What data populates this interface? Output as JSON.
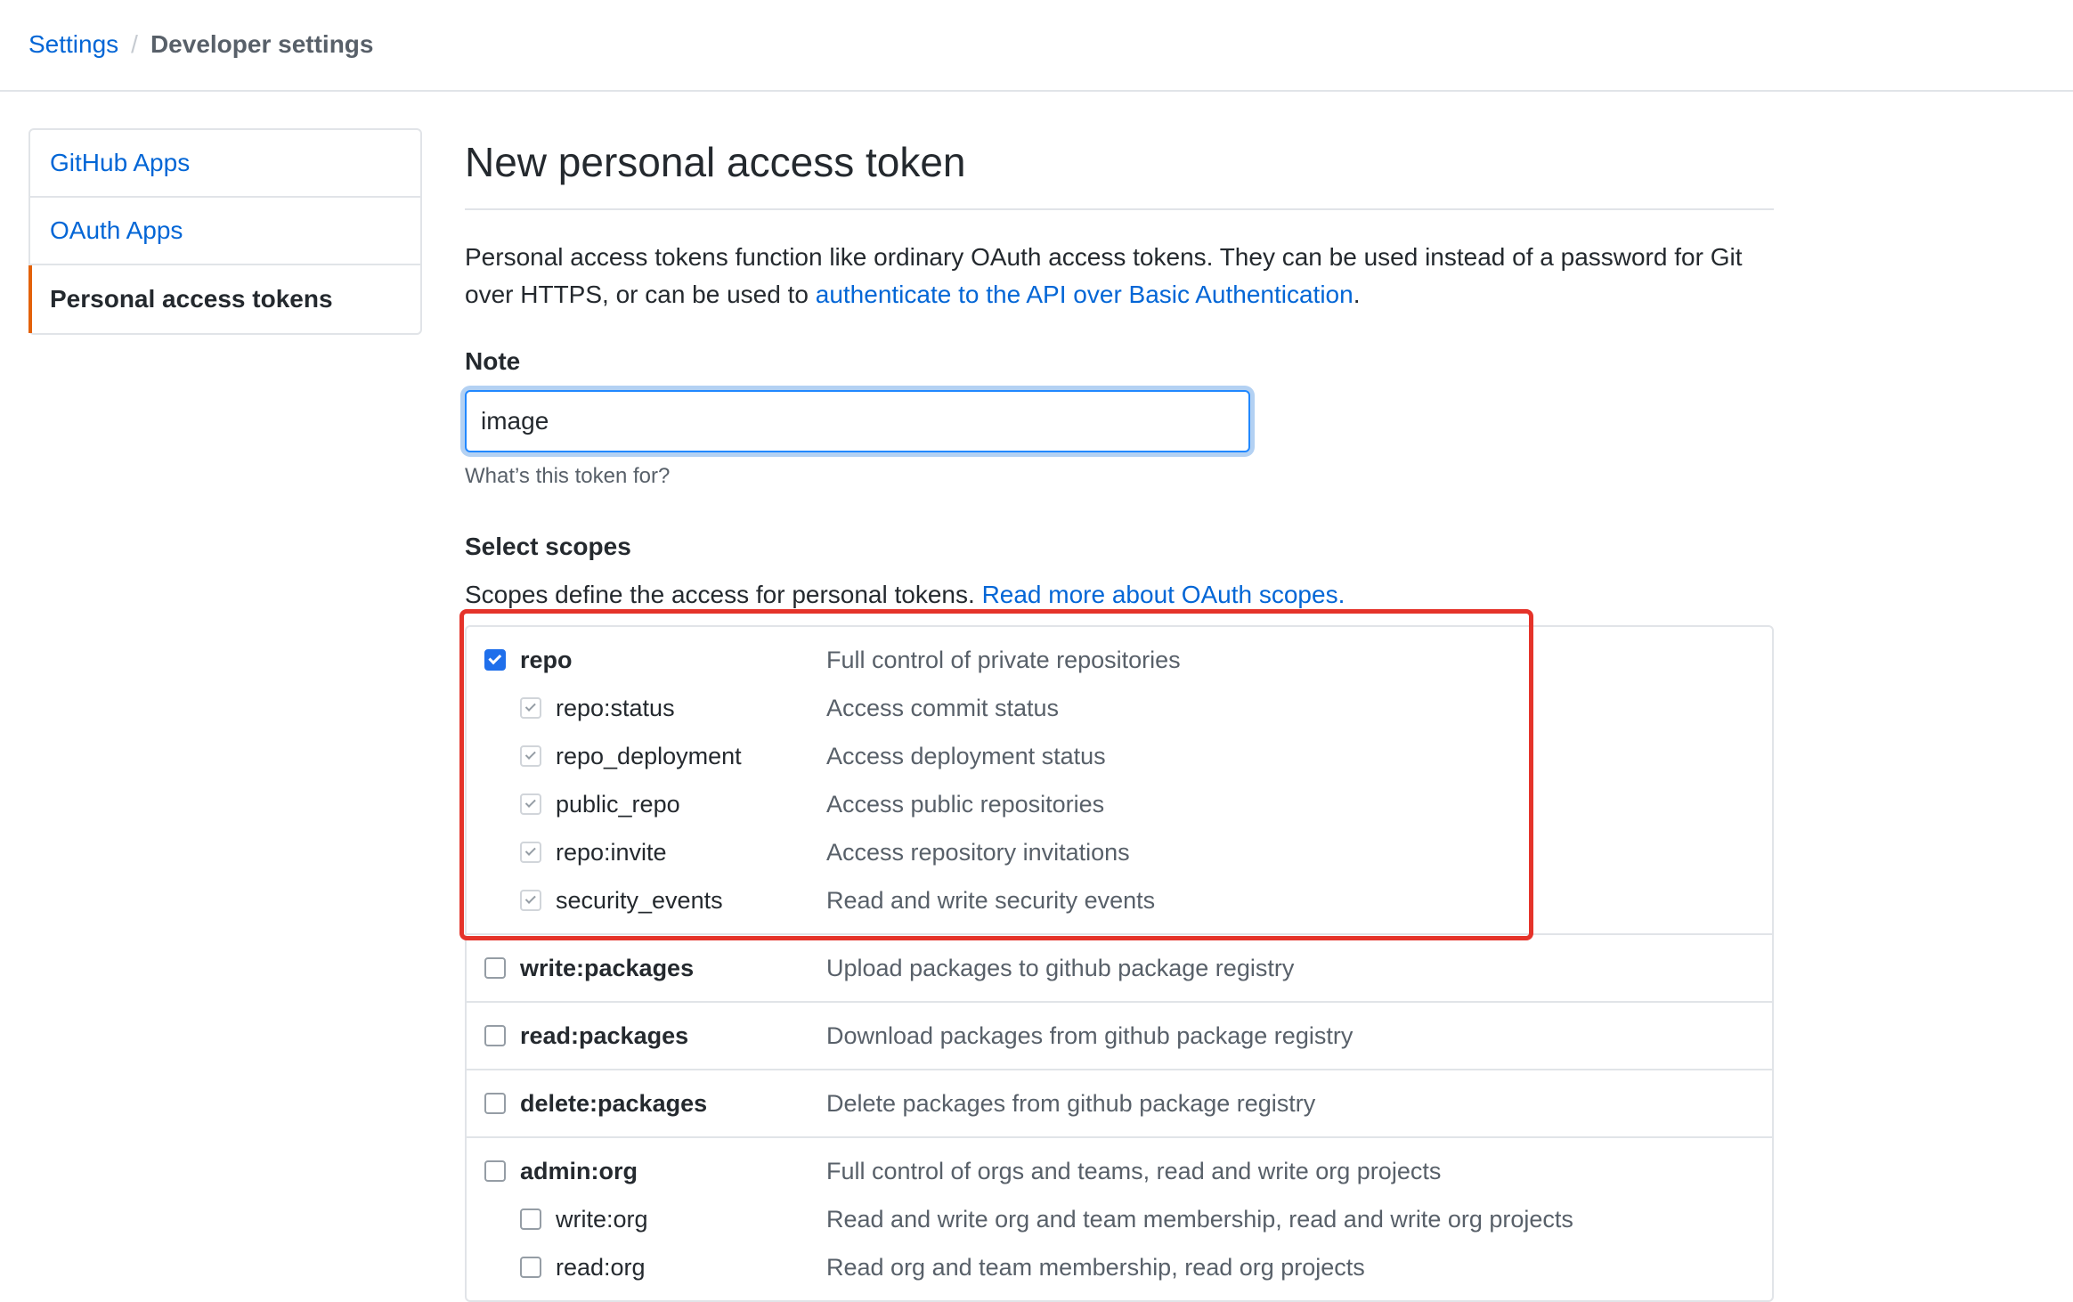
{
  "breadcrumb": {
    "settings": "Settings",
    "separator": "/",
    "current": "Developer settings"
  },
  "sidebar": {
    "items": [
      {
        "label": "GitHub Apps",
        "selected": false
      },
      {
        "label": "OAuth Apps",
        "selected": false
      },
      {
        "label": "Personal access tokens",
        "selected": true
      }
    ]
  },
  "main": {
    "title": "New personal access token",
    "intro_text": "Personal access tokens function like ordinary OAuth access tokens. They can be used instead of a password for Git over HTTPS, or can be used to ",
    "intro_link": "authenticate to the API over Basic Authentication",
    "intro_end": ".",
    "note_label": "Note",
    "note_value": "image",
    "note_hint": "What’s this token for?",
    "scopes_title": "Select scopes",
    "scopes_desc": "Scopes define the access for personal tokens. ",
    "scopes_link": "Read more about OAuth scopes."
  },
  "scopes": {
    "repo": {
      "name": "repo",
      "desc": "Full control of private repositories",
      "checked": true
    },
    "repo_status": {
      "name": "repo:status",
      "desc": "Access commit status",
      "checked": true
    },
    "repo_deployment": {
      "name": "repo_deployment",
      "desc": "Access deployment status",
      "checked": true
    },
    "public_repo": {
      "name": "public_repo",
      "desc": "Access public repositories",
      "checked": true
    },
    "repo_invite": {
      "name": "repo:invite",
      "desc": "Access repository invitations",
      "checked": true
    },
    "security_events": {
      "name": "security_events",
      "desc": "Read and write security events",
      "checked": true
    },
    "write_packages": {
      "name": "write:packages",
      "desc": "Upload packages to github package registry",
      "checked": false
    },
    "read_packages": {
      "name": "read:packages",
      "desc": "Download packages from github package registry",
      "checked": false
    },
    "delete_packages": {
      "name": "delete:packages",
      "desc": "Delete packages from github package registry",
      "checked": false
    },
    "admin_org": {
      "name": "admin:org",
      "desc": "Full control of orgs and teams, read and write org projects",
      "checked": false
    },
    "write_org": {
      "name": "write:org",
      "desc": "Read and write org and team membership, read and write org projects",
      "checked": false
    },
    "read_org": {
      "name": "read:org",
      "desc": "Read org and team membership, read org projects",
      "checked": false
    }
  },
  "colors": {
    "link": "#0366d6",
    "accent_orange": "#e36209",
    "checkbox_blue": "#1f6feb",
    "highlight_red": "#e5332a"
  }
}
